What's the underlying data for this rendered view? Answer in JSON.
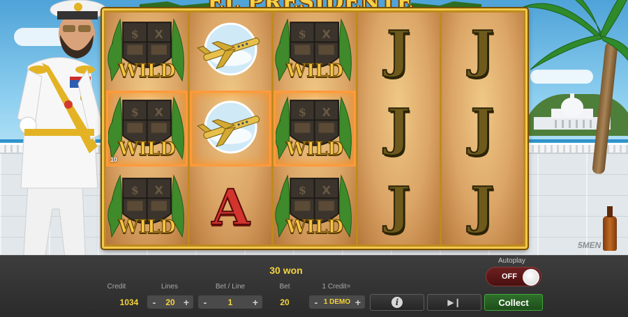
{
  "game": {
    "title": "EL PRESIDENTE",
    "brand": "5MEN"
  },
  "reels": [
    [
      {
        "symbol": "wild",
        "label": "WILD",
        "win": false
      },
      {
        "symbol": "wild",
        "label": "WILD",
        "win": true,
        "line_number": "10"
      },
      {
        "symbol": "wild",
        "label": "WILD",
        "win": false
      }
    ],
    [
      {
        "symbol": "jet",
        "label": "",
        "win": false
      },
      {
        "symbol": "jet",
        "label": "",
        "win": true
      },
      {
        "symbol": "ace",
        "label": "A",
        "win": false
      }
    ],
    [
      {
        "symbol": "wild",
        "label": "WILD",
        "win": false
      },
      {
        "symbol": "wild",
        "label": "WILD",
        "win": true
      },
      {
        "symbol": "wild",
        "label": "WILD",
        "win": false
      }
    ],
    [
      {
        "symbol": "jack",
        "label": "J",
        "win": false
      },
      {
        "symbol": "jack",
        "label": "J",
        "win": false
      },
      {
        "symbol": "jack",
        "label": "J",
        "win": false
      }
    ],
    [
      {
        "symbol": "jack",
        "label": "J",
        "win": false
      },
      {
        "symbol": "jack",
        "label": "J",
        "win": false
      },
      {
        "symbol": "jack",
        "label": "J",
        "win": false
      }
    ]
  ],
  "panel": {
    "win_message": "30 won",
    "credit": {
      "label": "Credit",
      "value": "1034"
    },
    "lines": {
      "label": "Lines",
      "value": "20",
      "minus": "-",
      "plus": "+"
    },
    "bet_line": {
      "label": "Bet / Line",
      "value": "1",
      "minus": "-",
      "plus": "+"
    },
    "bet": {
      "label": "Bet",
      "value": "20"
    },
    "credit_denom": {
      "label": "1 Credit=",
      "value": "1 DEMO",
      "minus": "-",
      "plus": "+"
    },
    "autoplay": {
      "label": "Autoplay",
      "state": "OFF"
    },
    "info_button": "i",
    "skip_button": "▶❙",
    "collect_button": "Collect"
  },
  "colors": {
    "accent_gold": "#f5d33a",
    "win_highlight": "#ff9a3c",
    "collect_green": "#3fa83a",
    "autoplay_off": "#6d2020"
  }
}
